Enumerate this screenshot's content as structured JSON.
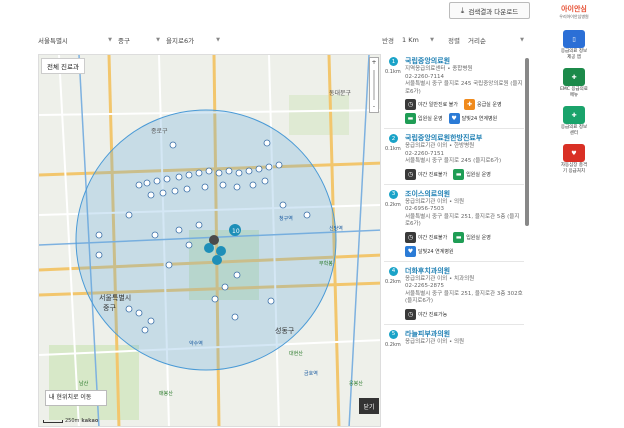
{
  "toolbar": {
    "download_label": "검색결과 다운로드"
  },
  "filters": {
    "sido": "서울특별시",
    "gu": "중구",
    "dong": "을지로6가",
    "radius_label": "반경",
    "radius_value": "1 Km",
    "sort_label": "정렬",
    "sort_value": "거리순"
  },
  "map": {
    "tag_all": "전체 진료과",
    "my_location": "내 현위치로 이동",
    "close": "닫기",
    "scale": "250m",
    "provider": "kakao",
    "zoom_in": "+",
    "zoom_out": "-",
    "labels": [
      "서울특별시",
      "중구",
      "성동구",
      "종로구",
      "동대문구",
      "무학봉",
      "대현산",
      "응봉산",
      "남산",
      "매봉산",
      "청구역",
      "신당역",
      "약수역",
      "금호역"
    ]
  },
  "list": [
    {
      "num": "1",
      "dist": "0.1km",
      "name": "국립중앙의료원",
      "meta": [
        "지역응급의료센터 • 종합병원",
        "02-2260-7114",
        "서울특별시 중구 을지로 245 국립중앙의료원 (을지로6가)"
      ],
      "badges": [
        {
          "label": "야간 일반진료 불가",
          "icon": "clock-icon",
          "tone": "dark"
        },
        {
          "label": "응급실 운영",
          "icon": "emergency-icon",
          "tone": "orange"
        },
        {
          "label": "입원실 운영",
          "icon": "bed-icon",
          "tone": "green"
        },
        {
          "label": "달빛24 연계병원",
          "icon": "heart-icon",
          "tone": "blue"
        }
      ]
    },
    {
      "num": "2",
      "dist": "0.1km",
      "name": "국립중앙의료원한방진료부",
      "meta": [
        "응급의료기관 이외 • 한방병원",
        "02-2260-7151",
        "서울특별시 중구 을지로 245 (을지로6가)"
      ],
      "badges": [
        {
          "label": "야간 진료불가",
          "icon": "clock-icon",
          "tone": "dark"
        },
        {
          "label": "입원실 운영",
          "icon": "bed-icon",
          "tone": "green"
        }
      ]
    },
    {
      "num": "3",
      "dist": "0.2km",
      "name": "조이스의료의원",
      "meta": [
        "응급의료기관 이외 • 의원",
        "02-6956-7503",
        "서울특별시 중구 을지로 251, 을지로관 5층 (을지로6가)"
      ],
      "badges": [
        {
          "label": "야간 진료불가",
          "icon": "clock-icon",
          "tone": "dark"
        },
        {
          "label": "입원실 운영",
          "icon": "bed-icon",
          "tone": "green"
        },
        {
          "label": "달빛24 연계병원",
          "icon": "heart-icon",
          "tone": "blue"
        }
      ]
    },
    {
      "num": "4",
      "dist": "0.2km",
      "name": "더화후치과의원",
      "meta": [
        "응급의료기관 이외 • 치과의원",
        "02-2265-2875",
        "서울특별시 중구 을지로 251, 을지로관 3층 302호 (을지로6가)"
      ],
      "badges": [
        {
          "label": "야간 진료가능",
          "icon": "clock-icon",
          "tone": "dark"
        }
      ]
    },
    {
      "num": "5",
      "dist": "0.2km",
      "name": "라늘피부과의원",
      "meta": [
        "응급의료기관 이외 • 의원"
      ],
      "badges": []
    }
  ],
  "sidebar": {
    "logo_title": "아이안심",
    "logo_sub": "우리아이안심병원",
    "apps": [
      {
        "caption": "응급의료 정보제공 앱",
        "color": "#2b6fd6",
        "glyph": "📱"
      },
      {
        "caption": "EMC 응급의료 메뉴",
        "color": "#1c8a4a",
        "glyph": "✚"
      },
      {
        "caption": "응급의료 정보 센터",
        "color": "#1aa36b",
        "glyph": "✚"
      },
      {
        "caption": "자동심장 충격기 응급처치",
        "color": "#d93025",
        "glyph": "♥"
      }
    ]
  }
}
